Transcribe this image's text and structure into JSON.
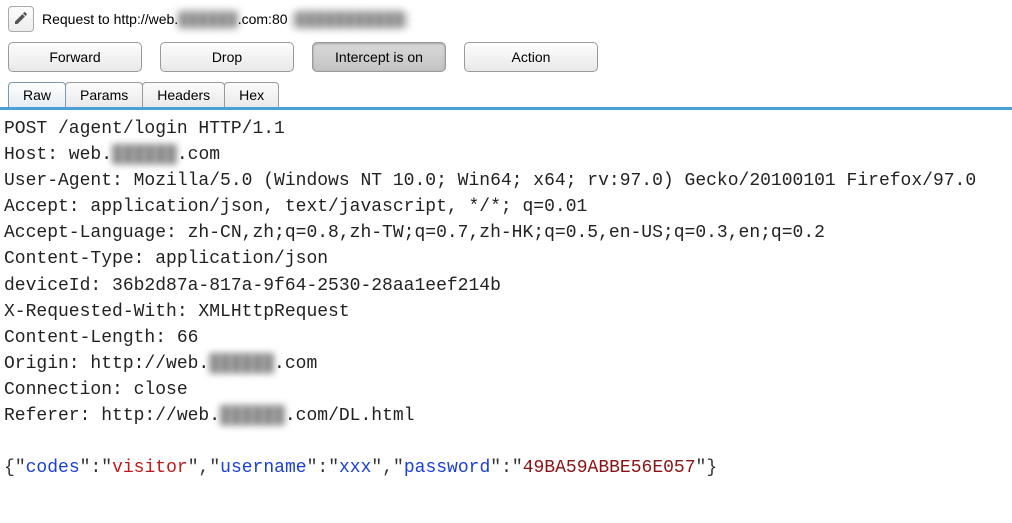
{
  "header": {
    "request_prefix": "Request to http://web.",
    "request_redacted": "██████",
    "request_suffix_a": ".com:80  ",
    "request_suffix_redacted": "[███████████]"
  },
  "buttons": {
    "forward": "Forward",
    "drop": "Drop",
    "intercept": "Intercept is on",
    "action": "Action"
  },
  "tabs": {
    "raw": "Raw",
    "params": "Params",
    "headers": "Headers",
    "hex": "Hex"
  },
  "raw": {
    "l1": "POST /agent/login HTTP/1.1",
    "l2a": "Host: web.",
    "l2b": "██████",
    "l2c": ".com",
    "l3": "User-Agent: Mozilla/5.0 (Windows NT 10.0; Win64; x64; rv:97.0) Gecko/20100101 Firefox/97.0",
    "l4": "Accept: application/json, text/javascript, */*; q=0.01",
    "l5": "Accept-Language: zh-CN,zh;q=0.8,zh-TW;q=0.7,zh-HK;q=0.5,en-US;q=0.3,en;q=0.2",
    "l6": "Content-Type: application/json",
    "l7": "deviceId: 36b2d87a-817a-9f64-2530-28aa1eef214b",
    "l8": "X-Requested-With: XMLHttpRequest",
    "l9": "Content-Length: 66",
    "l10a": "Origin: http://web.",
    "l10b": "██████",
    "l10c": ".com",
    "l11": "Connection: close",
    "l12a": "Referer: http://web.",
    "l12b": "██████",
    "l12c": ".com/DL.html"
  },
  "body": {
    "b1": "{",
    "q": "\"",
    "k1": "codes",
    "v1": "visitor",
    "k2": "username",
    "v2": "xxx",
    "k3": "password",
    "v3": "49BA59ABBE56E057",
    "colon": ":",
    "comma": ",",
    "b2": "}"
  }
}
